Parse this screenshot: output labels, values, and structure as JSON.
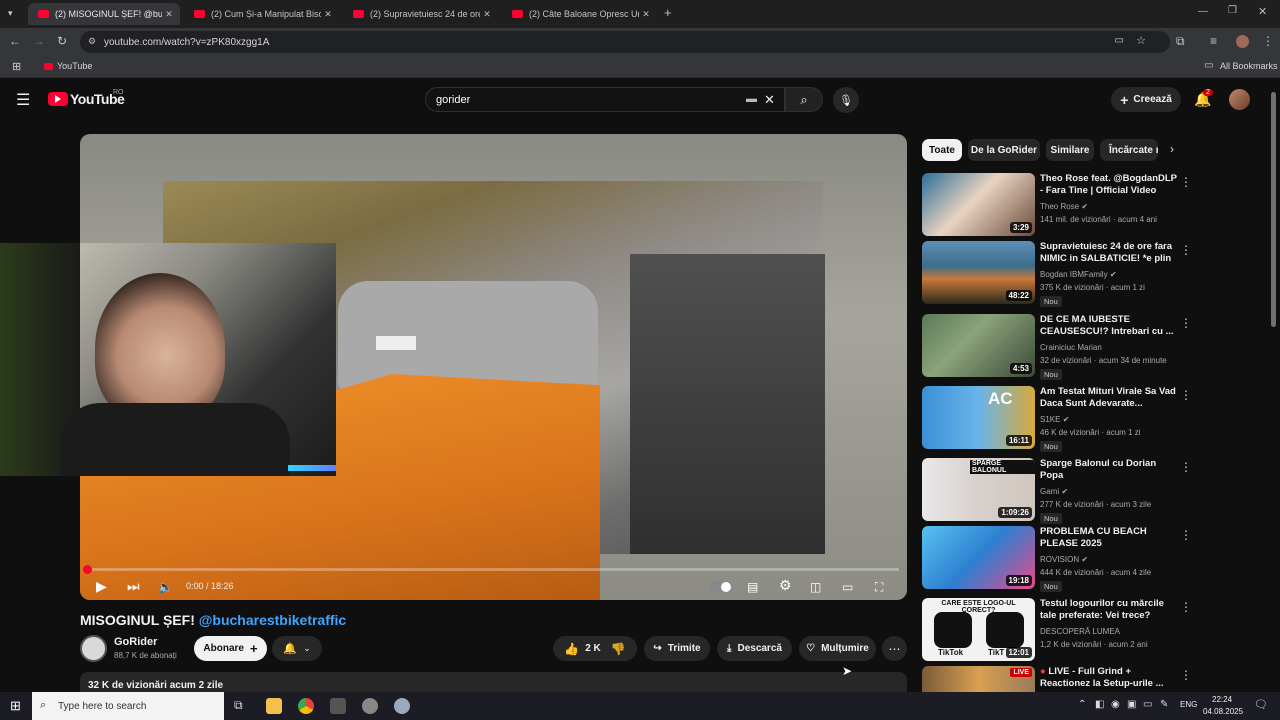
{
  "browser": {
    "tabs": [
      {
        "label": "(2) MISOGINUL ȘEF! @buchare..."
      },
      {
        "label": "(2) Cum Și-a Manipulat Bisoi Ca..."
      },
      {
        "label": "(2) Supravietuiesc 24 de ore fa..."
      },
      {
        "label": "(2) Câte Baloane Opresc Un Fie..."
      }
    ],
    "url": "youtube.com/watch?v=zPK80xzgg1A",
    "bookmark_youtube": "YouTube",
    "all_bookmarks": "All Bookmarks"
  },
  "youtube": {
    "logo": "YouTube",
    "region": "RO",
    "search_value": "gorider",
    "create_label": "Creează",
    "notif_count": "2"
  },
  "player": {
    "time": "0:00 / 18:26",
    "progress": 0.0
  },
  "video": {
    "title_prefix": "MISOGINUL ȘEF!",
    "title_mention": "@bucharestbiketraffic",
    "channel": "GoRider",
    "subscribers": "88,7 K de abonați",
    "subscribe": "Abonare",
    "likes": "2 K",
    "share": "Trimite",
    "download": "Descarcă",
    "thanks": "Mulțumire",
    "desc_stats": "32 K de vizionări  acum 2 zile"
  },
  "chips": [
    "Toate",
    "De la GoRider",
    "Similare",
    "Încărcate r"
  ],
  "recommendations": [
    {
      "title": "Theo Rose feat. @BogdanDLP - Fara Tine | Official Video",
      "channel": "Theo Rose",
      "meta": "141 mil. de vizionări · acum 4 ani",
      "duration": "3:29",
      "badge": ""
    },
    {
      "title": "Supravietuiesc 24 de ore fara NIMIC in SALBATICIE! *e plin ...",
      "channel": "Bogdan IBMFamily",
      "meta": "375 K de vizionări · acum 1 zi",
      "duration": "48:22",
      "badge": "Nou"
    },
    {
      "title": "DE CE MA IUBESTE CEAUSESCU!? Intrebari cu ...",
      "channel": "Crainiciuc Marian",
      "meta": "32 de vizionări · acum 34 de minute",
      "duration": "4:53",
      "badge": "Nou"
    },
    {
      "title": "Am Testat Mituri Virale Sa Vad Daca Sunt Adevarate...",
      "channel": "S1KE",
      "meta": "46 K de vizionări · acum 1 zi",
      "duration": "16:11",
      "badge": "Nou"
    },
    {
      "title": "Sparge Balonul cu Dorian Popa",
      "channel": "Gami",
      "meta": "277 K de vizionări · acum 3 zile",
      "duration": "1:09:26",
      "badge": "Nou"
    },
    {
      "title": "PROBLEMA CU BEACH PLEASE 2025",
      "channel": "ROVISION",
      "meta": "444 K de vizionări · acum 4 zile",
      "duration": "19:18",
      "badge": "Nou"
    },
    {
      "title": "Testul logourilor cu mărcile tale preferate: Vei trece?",
      "channel": "DESCOPERĂ LUMEA",
      "meta": "1,2 K de vizionări · acum 2 ani",
      "duration": "12:01",
      "badge": ""
    },
    {
      "title": "LIVE - Full Grind + Reactionez la Setup-urile ...",
      "channel": "",
      "meta": "",
      "duration": "LIVE",
      "badge": ""
    }
  ],
  "thumb_texts": {
    "ac": "AC",
    "sparge": "SPARGE BALONUL",
    "logo_q": "CARE ESTE LOGO-UL CORECT?",
    "tiktok1": "TikTok",
    "tiktok2": "TikT"
  },
  "taskbar": {
    "search_placeholder": "Type here to search",
    "lang": "ENG",
    "time": "22:24",
    "date": "04.08.2025"
  },
  "colors": {
    "accent": "#ff0033",
    "link": "#3ea6ff",
    "bg": "#0f0f0f"
  }
}
